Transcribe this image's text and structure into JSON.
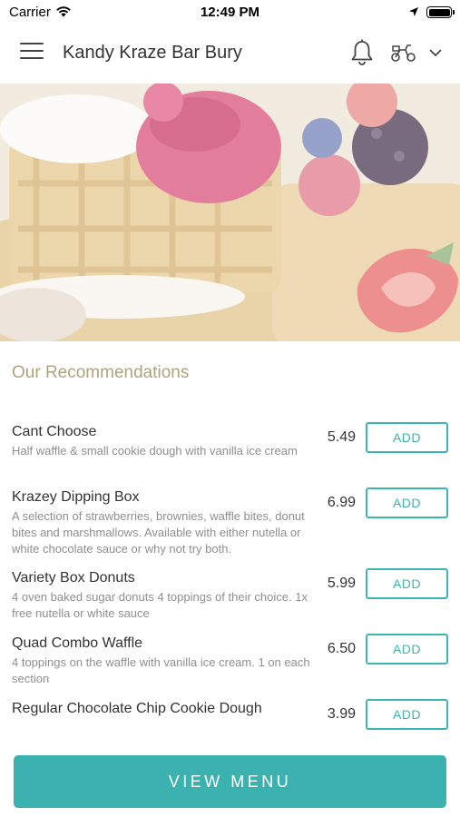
{
  "status_bar": {
    "carrier": "Carrier",
    "time": "12:49 PM"
  },
  "navbar": {
    "title": "Kandy Kraze Bar Bury",
    "icons": [
      "menu-icon",
      "bell-icon",
      "delivery-scooter-icon",
      "chevron-down-icon"
    ]
  },
  "recommendations": {
    "title": "Our Recommendations",
    "items": [
      {
        "name": "Cant Choose",
        "description": "Half waffle & small cookie dough with vanilla ice cream",
        "price": "5.49",
        "button": "ADD"
      },
      {
        "name": "Krazey Dipping Box",
        "description": "A selection of strawberries, brownies, waffle bites, donut bites and marshmallows. Available with either nutella or white chocolate sauce or why not try both.",
        "price": "6.99",
        "button": "ADD"
      },
      {
        "name": "Variety Box Donuts",
        "description": "4 oven baked sugar donuts 4 toppings of their choice. 1x free nutella or white sauce",
        "price": "5.99",
        "button": "ADD"
      },
      {
        "name": "Quad Combo Waffle",
        "description": "4 toppings on the waffle with vanilla ice cream. 1 on each section",
        "price": "6.50",
        "button": "ADD"
      },
      {
        "name": "Regular Chocolate Chip Cookie Dough",
        "description": "",
        "price": "3.99",
        "button": "ADD"
      }
    ]
  },
  "view_menu_label": "VIEW MENU",
  "colors": {
    "accent": "#3bb2af",
    "section_title": "#b0a27c"
  }
}
